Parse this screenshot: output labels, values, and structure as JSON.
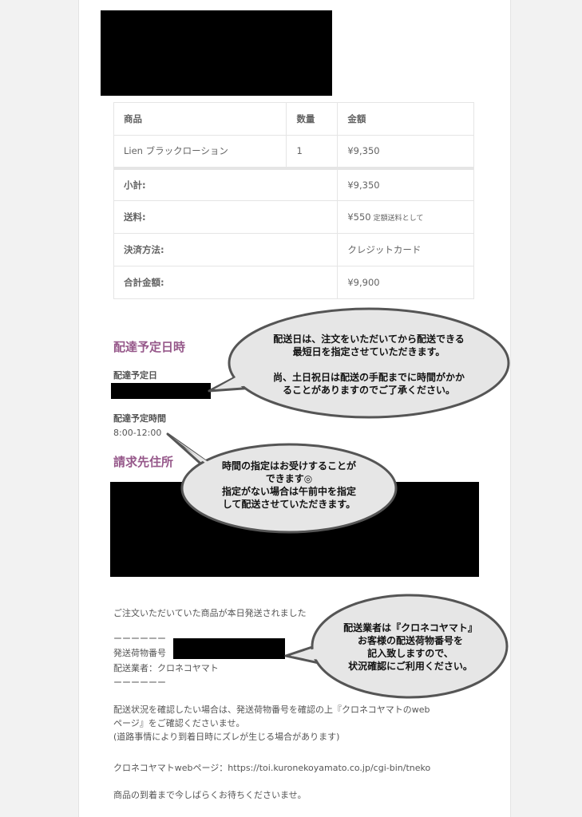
{
  "order": {
    "headers": [
      "商品",
      "数量",
      "金額"
    ],
    "item": {
      "name": "Lien ブラックローション",
      "qty": "1",
      "price": "¥9,350"
    },
    "subtotal_label": "小計:",
    "subtotal": "¥9,350",
    "shipping_label": "送料:",
    "shipping": "¥550",
    "shipping_note": "定額送料として",
    "payment_label": "決済方法:",
    "payment": "クレジットカード",
    "total_label": "合計金額:",
    "total": "¥9,900"
  },
  "delivery": {
    "heading": "配達予定日時",
    "date_label": "配達予定日",
    "time_label": "配達予定時間",
    "time_value": "8:00-12:00"
  },
  "billing": {
    "heading": "請求先住所"
  },
  "notice": {
    "shipped": "ご注文いただいていた商品が本日発送されました",
    "dashes": "ーーーーーー",
    "tracking_label": "発送荷物番号",
    "carrier_line": "配送業者：クロネコヤマト",
    "dashes2": "ーーーーーー",
    "para1_line1": "配送状況を確認したい場合は、発送荷物番号を確認の上『クロネコヤマトのweb",
    "para1_line2": "ページ』をご確認くださいませ。",
    "para1_line3": "(道路事情により到着日時にズレが生じる場合があります)",
    "web_line": "クロネコヤマトwebページ：https://toi.kuronekoyamato.co.jp/cgi-bin/tneko",
    "closing": "商品の到着まで今しばらくお待ちくださいませ。"
  },
  "callouts": {
    "c1": [
      "配送日は、注文をいただいてから配送できる",
      "最短日を指定させていただきます。",
      "",
      "尚、土日祝日は配送の手配までに時間がかか",
      "ることがありますのでご了承ください。"
    ],
    "c2": [
      "時間の指定はお受けすることが",
      "できます◎",
      "指定がない場合は午前中を指定",
      "して配送させていただきます。"
    ],
    "c3": [
      "配送業者は『クロネコヤマト』",
      "お客様の配送荷物番号を",
      "記入致しますので、",
      "状況確認にご利用ください。"
    ]
  },
  "colors": {
    "heading": "#96588a",
    "bubble": "#e6e6e6",
    "bubble_border": "#555555"
  }
}
